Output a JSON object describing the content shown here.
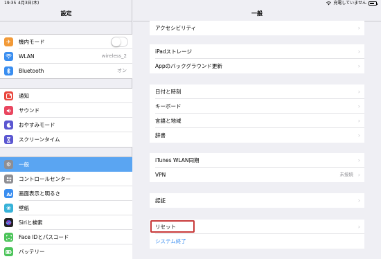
{
  "status_bar": {
    "time": "19:35",
    "date": "4月3日(木)",
    "right_text": "充電していません"
  },
  "sidebar": {
    "title": "設定",
    "groups": [
      {
        "items": [
          {
            "label": "機内モード",
            "icon": "airplane-icon",
            "color": "#f29a38",
            "value": "",
            "toggle": true
          },
          {
            "label": "WLAN",
            "icon": "wifi-icon",
            "color": "#3a8ef0",
            "value": "wireless_2"
          },
          {
            "label": "Bluetooth",
            "icon": "bluetooth-icon",
            "color": "#3a8ef0",
            "value": "オン"
          }
        ]
      },
      {
        "items": [
          {
            "label": "通知",
            "icon": "notification-icon",
            "color": "#e9463d"
          },
          {
            "label": "サウンド",
            "icon": "sound-icon",
            "color": "#e9465f"
          },
          {
            "label": "おやすみモード",
            "icon": "moon-icon",
            "color": "#5b57d1"
          },
          {
            "label": "スクリーンタイム",
            "icon": "hourglass-icon",
            "color": "#5b57d1"
          }
        ]
      },
      {
        "items": [
          {
            "label": "一般",
            "icon": "gear-icon",
            "color": "#8e8e93",
            "selected": true
          },
          {
            "label": "コントロールセンター",
            "icon": "control-center-icon",
            "color": "#8e8e93"
          },
          {
            "label": "画面表示と明るさ",
            "icon": "brightness-icon",
            "color": "#3a8ef0"
          },
          {
            "label": "壁紙",
            "icon": "wallpaper-icon",
            "color": "#37b2d8"
          },
          {
            "label": "Siriと検索",
            "icon": "siri-icon",
            "color": "#222222"
          },
          {
            "label": "Face IDとパスコード",
            "icon": "faceid-icon",
            "color": "#4cc45a"
          },
          {
            "label": "バッテリー",
            "icon": "battery-icon",
            "color": "#4cc45a"
          }
        ]
      }
    ]
  },
  "detail": {
    "title": "一般",
    "groups": [
      {
        "items": [
          {
            "label": "アクセシビリティ"
          }
        ]
      },
      {
        "items": [
          {
            "label": "iPadストレージ"
          },
          {
            "label": "Appのバックグラウンド更新"
          }
        ]
      },
      {
        "items": [
          {
            "label": "日付と時刻"
          },
          {
            "label": "キーボード"
          },
          {
            "label": "言語と地域"
          },
          {
            "label": "辞書"
          }
        ]
      },
      {
        "items": [
          {
            "label": "iTunes WLAN同期"
          },
          {
            "label": "VPN",
            "value": "未接続"
          }
        ]
      },
      {
        "items": [
          {
            "label": "認証"
          }
        ]
      },
      {
        "items": [
          {
            "label": "リセット"
          },
          {
            "label": "システム終了",
            "link": true
          }
        ]
      }
    ]
  }
}
